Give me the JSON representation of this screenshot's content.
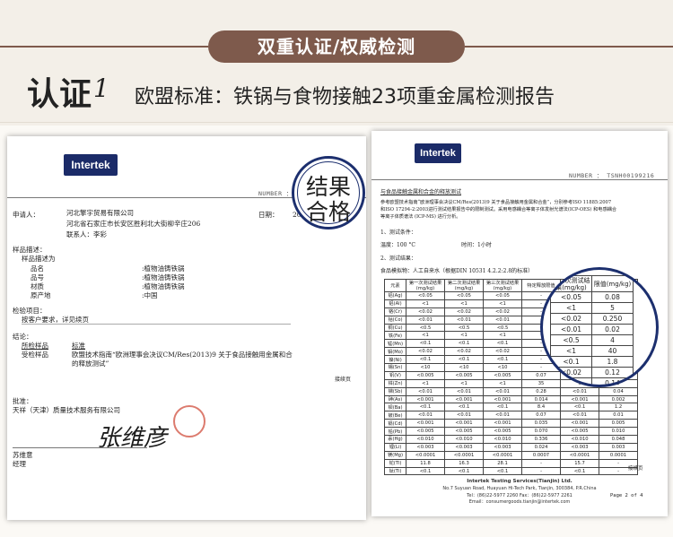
{
  "header": {
    "pill": "双重认证/权威检测",
    "cert_label": "认证",
    "cert_num": "1",
    "cert_title": "欧盟标准：铁锅与食物接触23项重金属检测报告"
  },
  "doc1": {
    "logo": "Intertek",
    "number": "NUMBER ： TSNH00199216",
    "applicant_label": "申请人：",
    "applicant_name": "河北擎宇贸易有限公司",
    "applicant_addr": "河北省石家庄市长安区胜利北大街柳辛庄206",
    "contact": "联系人：李彩",
    "date_label": "日期：",
    "date": "2016年7月18日",
    "sample_desc": "样品描述：",
    "sample_claimed": "样品描述为",
    "rows": [
      {
        "k": "品名",
        "v": ":植物油铸铁锅"
      },
      {
        "k": "品号",
        "v": ":植物油铸铁锅"
      },
      {
        "k": "材质",
        "v": ":植物油铸铁锅"
      },
      {
        "k": "原产地",
        "v": ":中国"
      }
    ],
    "test_items": "检验项目：",
    "test_items_text": "按客户要求，详见续页",
    "conclusion": "结论：",
    "col_test": "所检样品",
    "col_std": "标准",
    "test_sample": "受检样品",
    "std_text": "欧盟技术指南“欧洲理事会决议CM/Res(2013)9 关于食品接触用金属和合",
    "std_text2": "的释放测试”",
    "continued": "接续页",
    "approve": "批准：",
    "company": "天祥（天津）质量技术服务有限公司",
    "signer_role": "苏维意",
    "manager": "经理",
    "signature": "张维彦",
    "stamp_line1": "结果",
    "stamp_line2": "合格"
  },
  "doc2": {
    "logo": "Intertek",
    "number": "NUMBER ： TSNH00199216",
    "section_title": "与食品接触金属和合金的释放测试",
    "ref_text1": "参考欧盟技术指南“欧洲理事会决议CM/Res(2013)9 关于食品接触用金属和合金”，分别参考ISO 11885:2007",
    "ref_text2": "和ISO 17294-2:2003进行测试结果报告中的限制测试。采用电感耦合等离子体发射光谱法(ICP-OES) 和电感耦合",
    "ref_text3": "等离子体质谱法 (ICP-MS) 进行分析。",
    "cond_title": "1、测试条件：",
    "temp": "温度：100 °C",
    "time": "时间：1小时",
    "result_title": "2、测试结果：",
    "simulant": "食品模拟物：人工自来水（根据DIN 10531 4.2.2:2.8的标准）",
    "headers": [
      "元素",
      "第一次测试结果(mg/kg)",
      "第二次测试结果(mg/kg)",
      "第三次测试结果(mg/kg)",
      "特定释放限值",
      "第三次测试结果(mg/kg)",
      "限值(mg/kg)"
    ],
    "rows": [
      [
        "铝(Ag)",
        "<0.05",
        "<0.05",
        "<0.05",
        "-",
        "<0.05",
        "0.08"
      ],
      [
        "铝(Al)",
        "<1",
        "<1",
        "<1",
        "-",
        "<1",
        "5"
      ],
      [
        "铬(Cr)",
        "<0.02",
        "<0.02",
        "<0.02",
        "-",
        "<0.02",
        "0.250"
      ],
      [
        "钴(Co)",
        "<0.01",
        "<0.01",
        "<0.01",
        "-",
        "<0.01",
        "0.02"
      ],
      [
        "铜(Cu)",
        "<0.5",
        "<0.5",
        "<0.5",
        "-",
        "<0.5",
        "4"
      ],
      [
        "铁(Fe)",
        "<1",
        "<1",
        "<1",
        "-",
        "<1",
        "40"
      ],
      [
        "锰(Mn)",
        "<0.1",
        "<0.1",
        "<0.1",
        "-",
        "<0.1",
        "1.8"
      ],
      [
        "钼(Mo)",
        "<0.02",
        "<0.02",
        "<0.02",
        "-",
        "<0.02",
        "0.12"
      ],
      [
        "镍(Ni)",
        "<0.1",
        "<0.1",
        "<0.1",
        "-",
        "<0.1",
        "0.14"
      ],
      [
        "锡(Sn)",
        "<10",
        "<10",
        "<10",
        "-",
        "<10",
        "100"
      ],
      [
        "钒(V)",
        "<0.005",
        "<0.005",
        "<0.005",
        "0.07",
        "-",
        "0.01"
      ],
      [
        "锌(Zn)",
        "<1",
        "<1",
        "<1",
        "35",
        "3",
        "5"
      ],
      [
        "锑(Sb)",
        "<0.01",
        "<0.01",
        "<0.01",
        "0.28",
        "<0.01",
        "0.04"
      ],
      [
        "砷(As)",
        "<0.001",
        "<0.001",
        "<0.001",
        "0.014",
        "<0.001",
        "0.002"
      ],
      [
        "钡(Ba)",
        "<0.1",
        "<0.1",
        "<0.1",
        "8.4",
        "<0.1",
        "1.2"
      ],
      [
        "铍(Be)",
        "<0.01",
        "<0.01",
        "<0.01",
        "0.07",
        "<0.01",
        "0.01"
      ],
      [
        "镉(Cd)",
        "<0.001",
        "<0.001",
        "<0.001",
        "0.035",
        "<0.001",
        "0.005"
      ],
      [
        "铅(Pb)",
        "<0.005",
        "<0.005",
        "<0.005",
        "0.070",
        "<0.005",
        "0.010"
      ],
      [
        "汞(Hg)",
        "<0.010",
        "<0.010",
        "<0.010",
        "0.336",
        "<0.010",
        "0.048"
      ],
      [
        "锂(Li)",
        "<0.003",
        "<0.003",
        "<0.003",
        "0.024",
        "<0.003",
        "0.003"
      ],
      [
        "镁(Mg)",
        "<0.0001",
        "<0.0001",
        "<0.0001",
        "0.0007",
        "<0.0001",
        "0.0001"
      ],
      [
        "铊(Tl)",
        "11.8",
        "16.3",
        "28.1",
        "-",
        "15.7",
        "-"
      ],
      [
        "钛(Ti)",
        "<0.1",
        "<0.1",
        "<0.1",
        "-",
        "<0.1",
        "-"
      ]
    ],
    "continued": "接续页",
    "footer_name": "Intertek Testing Services(Tianjin) Ltd.",
    "footer_addr": "No.7 Suyuan Road, Huayuan Hi-Tech Park, Tianjin, 300384, P.R.China",
    "footer_tel": "Tel：(86)22-5977 2260   Fax：(86)22-5977 2261",
    "footer_email": "Email：consumergoods.tianjin@intertek.com",
    "page": "Page 2 of 4",
    "lens_header_a": "第三次测试结果(mg/kg)",
    "lens_header_b": "限值(mg/kg)"
  }
}
